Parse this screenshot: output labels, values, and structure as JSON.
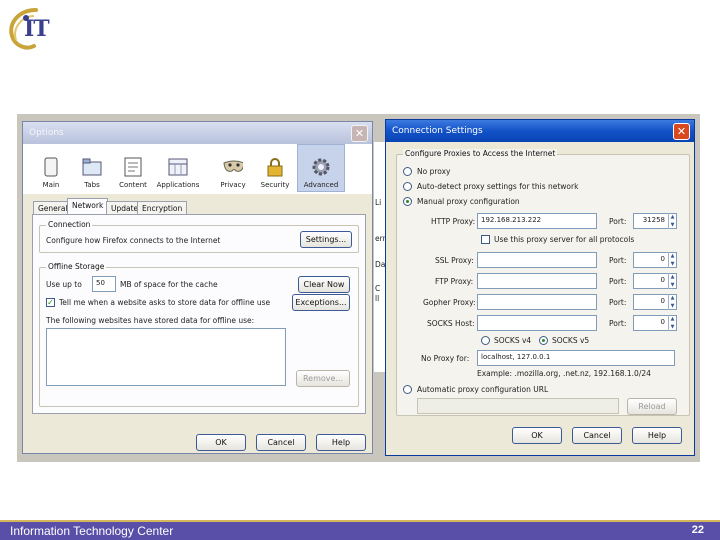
{
  "logo": {
    "text": "IT"
  },
  "options_dialog": {
    "title": "Options",
    "panes": [
      {
        "label": "Main",
        "icon": "switch-icon"
      },
      {
        "label": "Tabs",
        "icon": "tabs-icon"
      },
      {
        "label": "Content",
        "icon": "content-icon"
      },
      {
        "label": "Applications",
        "icon": "applications-icon"
      },
      {
        "label": "Privacy",
        "icon": "mask-icon"
      },
      {
        "label": "Security",
        "icon": "lock-icon"
      },
      {
        "label": "Advanced",
        "icon": "gear-icon"
      }
    ],
    "tabs": [
      "General",
      "Network",
      "Update",
      "Encryption"
    ],
    "connection": {
      "title": "Connection",
      "description": "Configure how Firefox connects to the Internet",
      "settings_button": "Settings..."
    },
    "offline": {
      "title": "Offline Storage",
      "use_up_to_prefix": "Use up to",
      "use_up_to_value": "50",
      "use_up_to_suffix": "MB of space for the cache",
      "clear_now_button": "Clear Now",
      "tell_me_label": "Tell me when a website asks to store data for offline use",
      "exceptions_button": "Exceptions...",
      "stored_sites_label": "The following websites have stored data for offline use:",
      "remove_button": "Remove..."
    },
    "buttons": {
      "ok": "OK",
      "cancel": "Cancel",
      "help": "Help"
    }
  },
  "background_fragments": [
    "Li",
    "ern",
    "Da",
    "C",
    "ll"
  ],
  "connection_settings": {
    "title": "Connection Settings",
    "group_title": "Configure Proxies to Access the Internet",
    "options": {
      "no_proxy": "No proxy",
      "auto_detect": "Auto-detect proxy settings for this network",
      "manual": "Manual proxy configuration",
      "automatic_url": "Automatic proxy configuration URL"
    },
    "http_proxy_label": "HTTP Proxy:",
    "http_proxy_value": "192.168.213.222",
    "port_label": "Port:",
    "http_port_value": "31258",
    "use_same_label": "Use this proxy server for all protocols",
    "ssl_proxy_label": "SSL Proxy:",
    "ftp_proxy_label": "FTP Proxy:",
    "gopher_proxy_label": "Gopher Proxy:",
    "socks_host_label": "SOCKS Host:",
    "zero_port": "0",
    "socks_v4": "SOCKS v4",
    "socks_v5": "SOCKS v5",
    "no_proxy_for_label": "No Proxy for:",
    "no_proxy_for_value": "localhost, 127.0.0.1",
    "example": "Example: .mozilla.org, .net.nz, 192.168.1.0/24",
    "reload_button": "Reload",
    "buttons": {
      "ok": "OK",
      "cancel": "Cancel",
      "help": "Help"
    }
  },
  "footer": {
    "title": "Information Technology Center",
    "page_number": "22"
  },
  "colors": {
    "footer_bar": "#5a4fa8",
    "footer_line": "#d6b65b",
    "titlebar_active": "#1252c8"
  }
}
